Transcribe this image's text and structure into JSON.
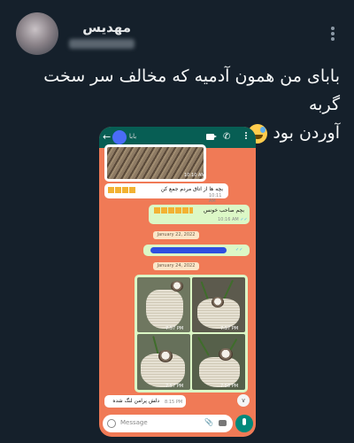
{
  "tweet": {
    "display_name": "مهدیس",
    "text_line1": "بابای من همون آدمیه که مخالف سر سخت گربه",
    "text_line2": "آوردن بود"
  },
  "whatsapp": {
    "contact_name": "بابا",
    "messages": {
      "photo1_time": "10:10 AM",
      "in1_text": "بچه ها از اتاق مردم جمع کن",
      "in1_time": "10:11 AM",
      "out1_text": "بچم صاحب خونس",
      "out1_time": "10:16 AM",
      "date1": "January 22, 2022",
      "date2": "January 24, 2022",
      "grid_times": [
        "7:57 PM",
        "7:57 PM",
        "7:57 PM",
        "7:58 PM"
      ],
      "in2_text": "دلش پرامن لنگ شده",
      "in2_time": "8:15 PM"
    },
    "input_placeholder": "Message"
  },
  "colors": {
    "background": "#15202b",
    "whatsapp_header": "#075e54",
    "chat_wallpaper": "#f07a56",
    "outgoing_bubble": "#dcf8c6"
  }
}
